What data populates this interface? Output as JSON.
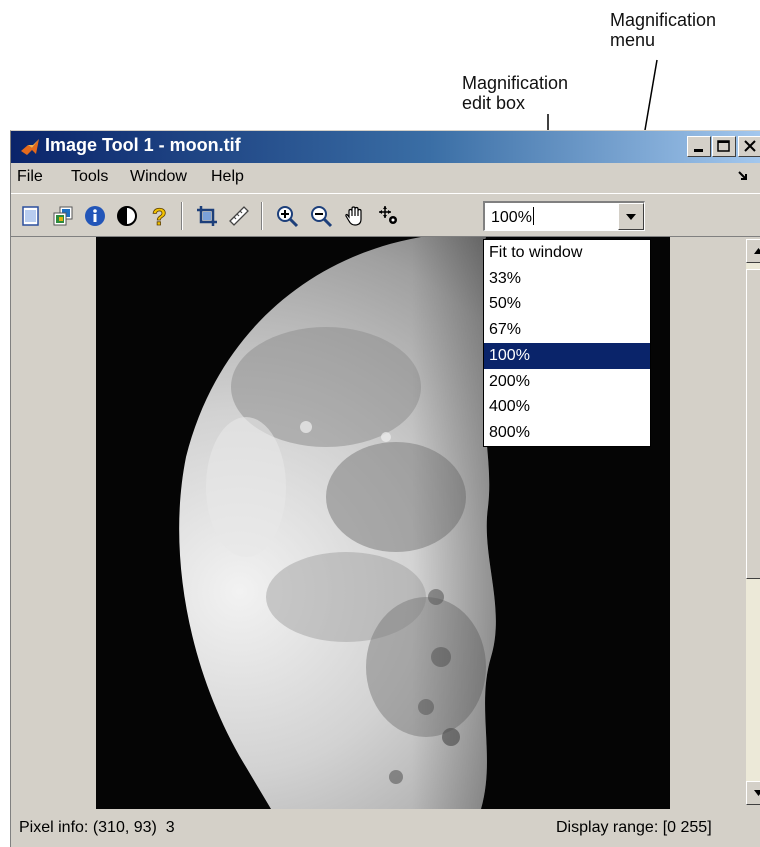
{
  "annotations": {
    "magnification_menu": [
      "Magnification",
      "menu"
    ],
    "magnification_edit_box": [
      "Magnification",
      "edit box"
    ]
  },
  "window": {
    "title": "Image Tool 1 - moon.tif"
  },
  "menubar": {
    "items": [
      "File",
      "Tools",
      "Window",
      "Help"
    ]
  },
  "toolbar": {
    "icons": [
      "new-figure-icon",
      "image-info-overview-icon",
      "info-icon",
      "contrast-icon",
      "help-icon",
      "crop-icon",
      "measure-distance-icon",
      "zoom-in-icon",
      "zoom-out-icon",
      "pan-hand-icon",
      "pixel-region-icon"
    ],
    "magnification_value": "100%"
  },
  "magnification_menu": {
    "options": [
      "Fit to window",
      "33%",
      "50%",
      "67%",
      "100%",
      "200%",
      "400%",
      "800%"
    ],
    "selected": "100%"
  },
  "statusbar": {
    "pixel_info": "Pixel info: (310, 93)  3",
    "display_range": "Display range: [0 255]"
  },
  "colors": {
    "title_gradient_start": "#0a246a",
    "menu_selection": "#0a246a",
    "chrome": "#d4d0c8"
  }
}
